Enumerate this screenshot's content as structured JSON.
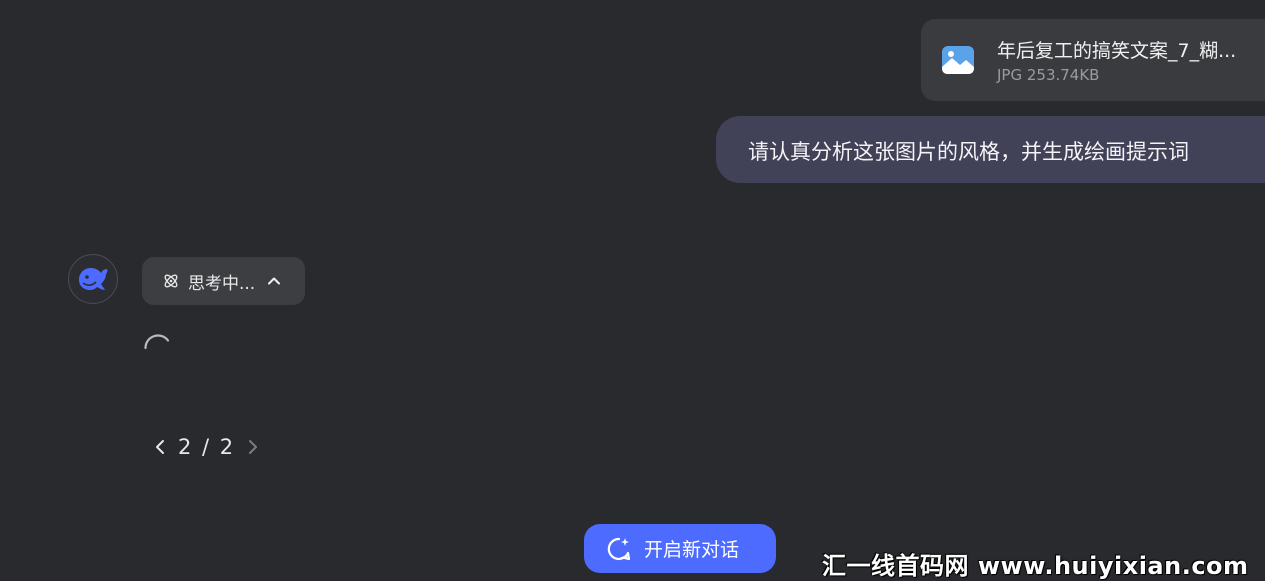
{
  "file_attachment": {
    "name": "年后复工的搞笑文案_7_糊...",
    "meta": "JPG 253.74KB",
    "icon": "image-file-icon"
  },
  "user_message": {
    "text": "请认真分析这张图片的风格，并生成绘画提示词"
  },
  "assistant": {
    "avatar_icon": "deepseek-whale-icon",
    "thinking_label": "思考中...",
    "status": "loading"
  },
  "pagination": {
    "label": "2 / 2"
  },
  "new_chat_button": {
    "label": "开启新对话"
  },
  "watermark": {
    "text": "汇一线首码网 www.huiyixian.com"
  },
  "colors": {
    "background": "#292a2d",
    "accent": "#4d6bfe",
    "user_bubble": "#414158"
  }
}
